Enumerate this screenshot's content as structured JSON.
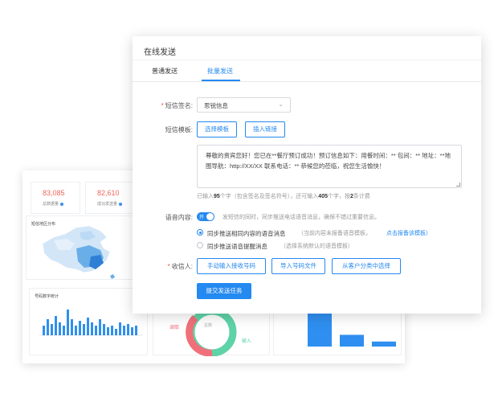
{
  "background_dashboard": {
    "stats": [
      {
        "value": "83,085",
        "label": "总数据量"
      },
      {
        "value": "82,610",
        "label": "成功发送量"
      }
    ],
    "map_panel_title": "短信地区分布",
    "bar_panel_title": "号码数字统计",
    "donut": {
      "center_label": "总数",
      "left_label": "调取",
      "right_label": "输入",
      "colors": [
        "#f0707a",
        "#5fd3a8"
      ]
    },
    "bar_chart_colors": [
      "#2f8ff0"
    ],
    "small_bars": [
      0.3,
      0.5,
      0.35,
      0.6,
      0.4,
      0.3,
      0.8,
      0.5,
      0.3,
      0.45,
      0.35,
      0.55,
      0.4,
      0.3,
      0.5,
      0.35,
      0.25,
      0.3,
      0.2,
      0.4,
      0.3,
      0.35,
      0.25,
      0.3
    ],
    "right_bars": [
      1.0,
      0.28,
      0.12
    ]
  },
  "dialog": {
    "title": "在线发送",
    "tabs": [
      {
        "label": "普通发送",
        "active": false
      },
      {
        "label": "批量发送",
        "active": true
      }
    ],
    "signature": {
      "label": "短信签名:",
      "value": "思锐信息"
    },
    "template": {
      "label": "短信模板:",
      "select_button": "选择模板",
      "insert_link_button": "插入链接"
    },
    "message": {
      "text": "尊敬的贵宾您好！您已在**餐厅预订成功！预订信息如下：用餐时间：** 包间：** 地址：**地图导航：http://XX/XX 联系电话：** 恭候您的莅临，祝您生活愉快！",
      "count_prefix": "已输入",
      "count_value": "95",
      "count_mid": "个字（包含签名及签名符号），还可输入",
      "remain_value": "405",
      "count_mid2": "个字，按",
      "split_value": "2",
      "count_suffix": "条计费"
    },
    "voice": {
      "label": "语音内容:",
      "toggle_text": "开",
      "description": "发短信的同时，同步推送电话语音消息，确保不错过重要信息。",
      "option1": "同步推送相同内容的语音消息",
      "option1_note": "（当前内容未报备语音模板，",
      "option1_link": "点击报备该模板）",
      "option2": "同步推送语音提醒消息",
      "option2_note": "（选择系统默认的语音模板）"
    },
    "recipients": {
      "label": "收信人:",
      "manual_button": "手动输入接收号码",
      "import_button": "导入号码文件",
      "category_button": "从客户分类中选择"
    },
    "submit_button": "提交发送任务",
    "accent_color": "#2489f0"
  }
}
